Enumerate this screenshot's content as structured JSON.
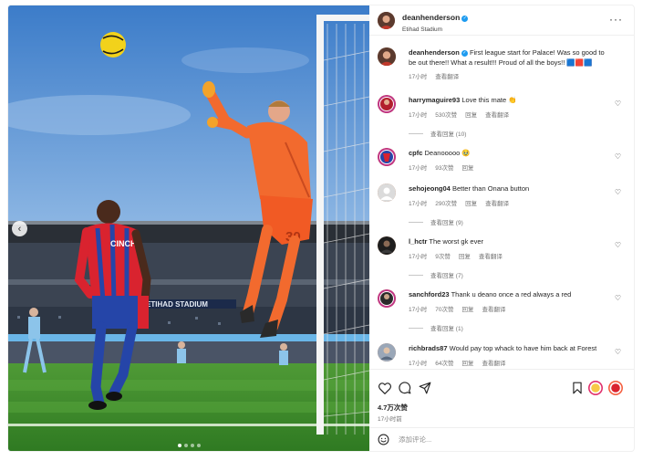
{
  "post": {
    "username": "deanhenderson",
    "location": "Etihad Stadium",
    "more_icon": "more-horizontal-icon",
    "stadium_sign": "ETIHAD STADIUM",
    "shirt_number": "30",
    "shirt_sponsor": "CINCH"
  },
  "caption": {
    "username": "deanhenderson",
    "text": "First league start for Palace! Was so good to be out there!! What a result!!! Proud of all the boys!! 🟦🟥🟦",
    "time": "17小时",
    "translate": "查看翻译"
  },
  "comments": [
    {
      "username": "harrymaguire93",
      "text": "Love this mate 👏",
      "time": "17小时",
      "likes": "530次赞",
      "reply": "回复",
      "translate": "查看翻译",
      "replies": "查看回复 (10)"
    },
    {
      "username": "cpfc",
      "text": "Deanooooo 🥹",
      "time": "17小时",
      "likes": "93次赞",
      "reply": "回复",
      "translate": "",
      "replies": ""
    },
    {
      "username": "sehojeong04",
      "text": "Better than Onana button",
      "time": "17小时",
      "likes": "290次赞",
      "reply": "回复",
      "translate": "查看翻译",
      "replies": "查看回复 (9)"
    },
    {
      "username": "l_hctr",
      "text": "The worst gk ever",
      "time": "17小时",
      "likes": "9次赞",
      "reply": "回复",
      "translate": "查看翻译",
      "replies": "查看回复 (7)"
    },
    {
      "username": "sanchford23",
      "text": "Thank u deano once a red always a red",
      "time": "17小时",
      "likes": "70次赞",
      "reply": "回复",
      "translate": "查看翻译",
      "replies": "查看回复 (1)"
    },
    {
      "username": "richbrads87",
      "text": "Would pay top whack to have him back at Forest",
      "time": "17小时",
      "likes": "64次赞",
      "reply": "回复",
      "translate": "查看翻译",
      "replies": ""
    }
  ],
  "actions": {
    "like_icon": "heart-icon",
    "comment_icon": "comment-icon",
    "share_icon": "send-icon",
    "save_icon": "bookmark-icon",
    "likes_count": "4.7万次赞",
    "time_ago": "17小时前"
  },
  "add_comment": {
    "placeholder": "添加评论...",
    "emoji_icon": "emoji-icon"
  },
  "carousel": {
    "total": 4,
    "active": 1
  },
  "colors": {
    "palace_red": "#d9232f",
    "palace_blue": "#2545a8",
    "keeper_orange": "#f26a2e",
    "sky": "#4a86cf",
    "pitch": "#3f8a2e",
    "verified": "#1d9bf0"
  }
}
